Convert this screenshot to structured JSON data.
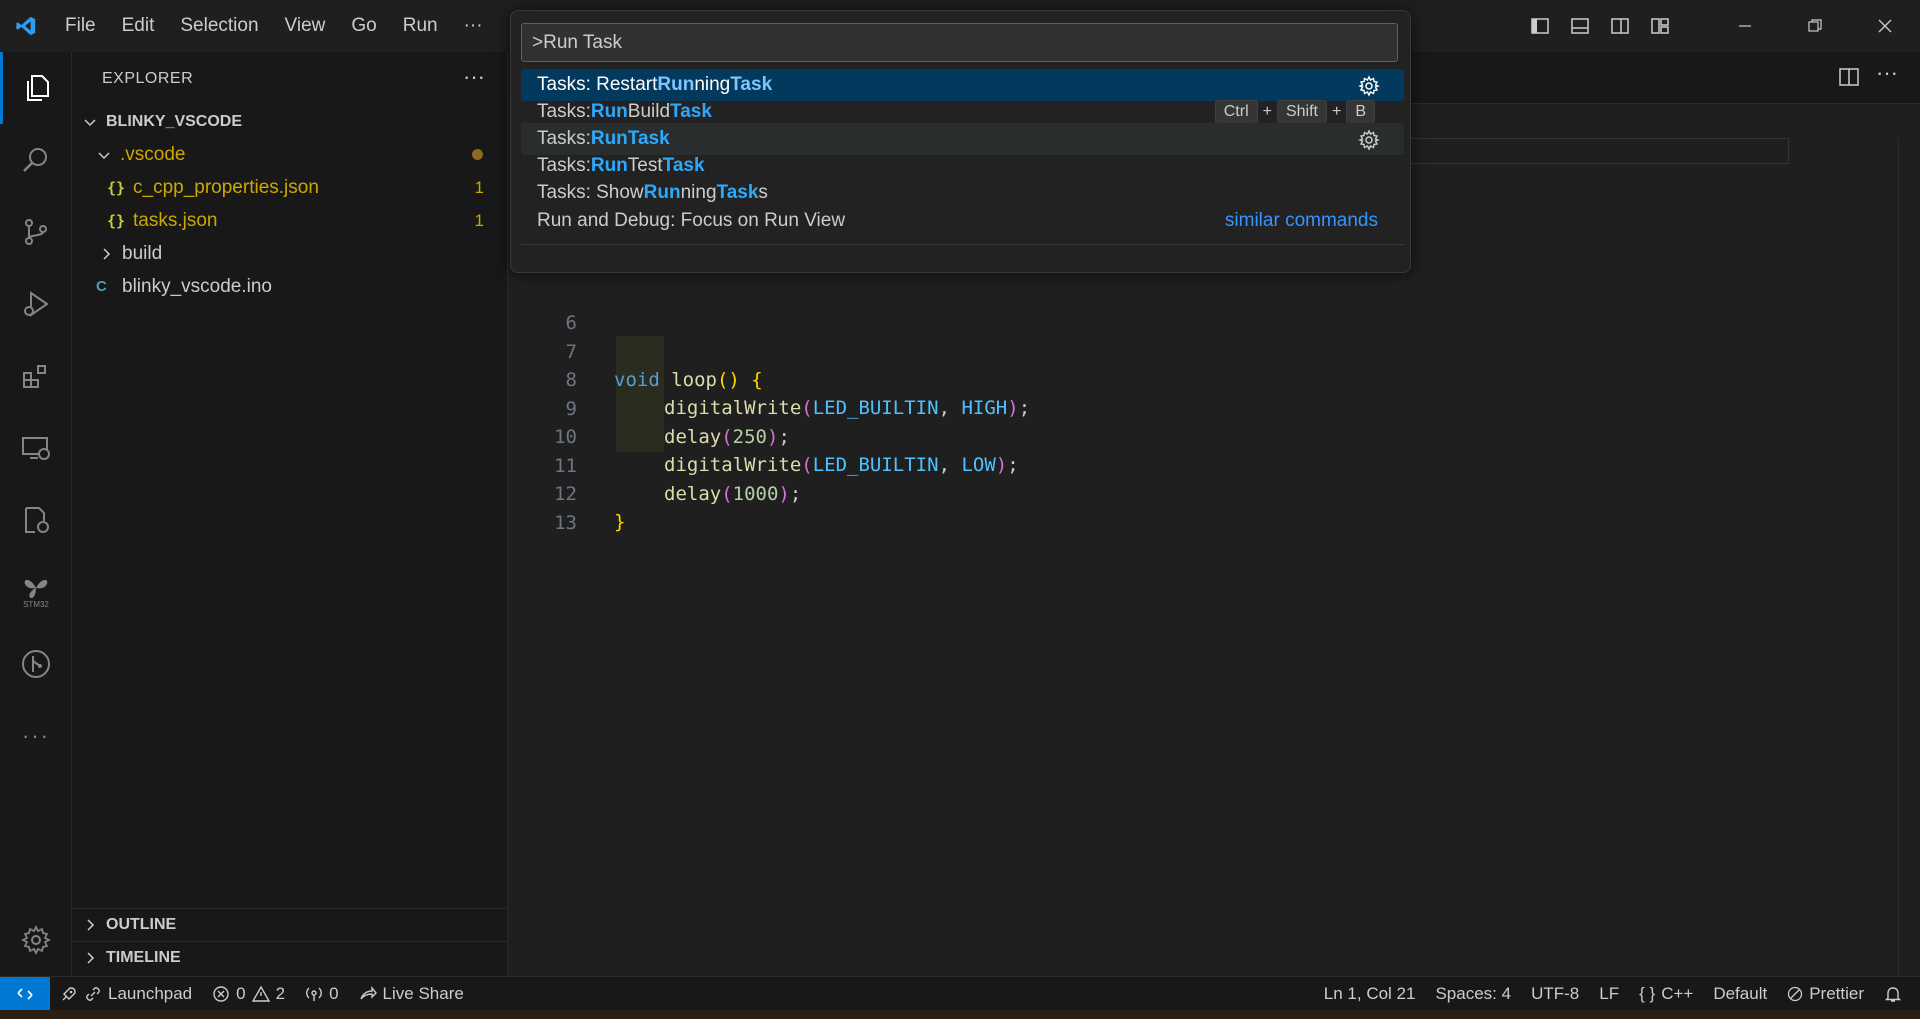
{
  "menu": [
    "File",
    "Edit",
    "Selection",
    "View",
    "Go",
    "Run"
  ],
  "menu_more": "···",
  "explorer": {
    "title": "EXPLORER",
    "more": "···",
    "workspace": "BLINKY_VSCODE",
    "items": [
      {
        "name": ".vscode",
        "type": "folder-open"
      },
      {
        "name": "c_cpp_properties.json",
        "icon": "{}",
        "badge": "1"
      },
      {
        "name": "tasks.json",
        "icon": "{}",
        "badge": "1"
      },
      {
        "name": "build",
        "type": "folder-closed"
      },
      {
        "name": "blinky_vscode.ino",
        "icon": "C"
      }
    ],
    "outline": "OUTLINE",
    "timeline": "TIMELINE"
  },
  "activity_labels": {
    "stm32": "STM32"
  },
  "palette": {
    "input_value": ">Run Task",
    "rows": [
      {
        "prefix": "Tasks: Restart ",
        "hl1": "Run",
        "mid": "ning ",
        "hl2": "Task",
        "suffix": ""
      },
      {
        "prefix": "Tasks: ",
        "hl1": "Run",
        "mid": " Build ",
        "hl2": "Task",
        "suffix": ""
      },
      {
        "prefix": "Tasks: ",
        "hl1": "Run",
        "mid": " ",
        "hl2": "Task",
        "suffix": ""
      },
      {
        "prefix": "Tasks: ",
        "hl1": "Run",
        "mid": " Test ",
        "hl2": "Task",
        "suffix": ""
      },
      {
        "prefix": "Tasks: Show ",
        "hl1": "Run",
        "mid": "ning ",
        "hl2": "Task",
        "suffix": "s"
      }
    ],
    "keybinding": [
      "Ctrl",
      "Shift",
      "B"
    ],
    "plus": "+",
    "last_row": "Run and Debug: Focus on Run View",
    "similar": "similar commands"
  },
  "code": {
    "lines": [
      "6",
      "7",
      "8",
      "9",
      "10",
      "11",
      "12",
      "13"
    ],
    "l7_kw": "void",
    "l7_fn": "loop",
    "l7_rest": "() {",
    "l8_fn": "digitalWrite",
    "l8_a": "LED_BUILTIN",
    "l8_b": "HIGH",
    "l9_fn": "delay",
    "l9_n": "250",
    "l10_fn": "digitalWrite",
    "l10_a": "LED_BUILTIN",
    "l10_b": "LOW",
    "l11_fn": "delay",
    "l11_n": "1000",
    "l12": "}"
  },
  "status": {
    "launchpad": "Launchpad",
    "errors": "0",
    "warnings": "2",
    "ports": "0",
    "live_share": "Live Share",
    "position": "Ln 1, Col 21",
    "spaces": "Spaces: 4",
    "encoding": "UTF-8",
    "eol": "LF",
    "language": "C++",
    "language_icon": "{ }",
    "profile": "Default",
    "prettier": "Prettier"
  },
  "colors": {
    "accent": "#0078d4",
    "highlight": "#2aaaff",
    "json_icon": "#cbcb41",
    "modified": "#cca700"
  }
}
